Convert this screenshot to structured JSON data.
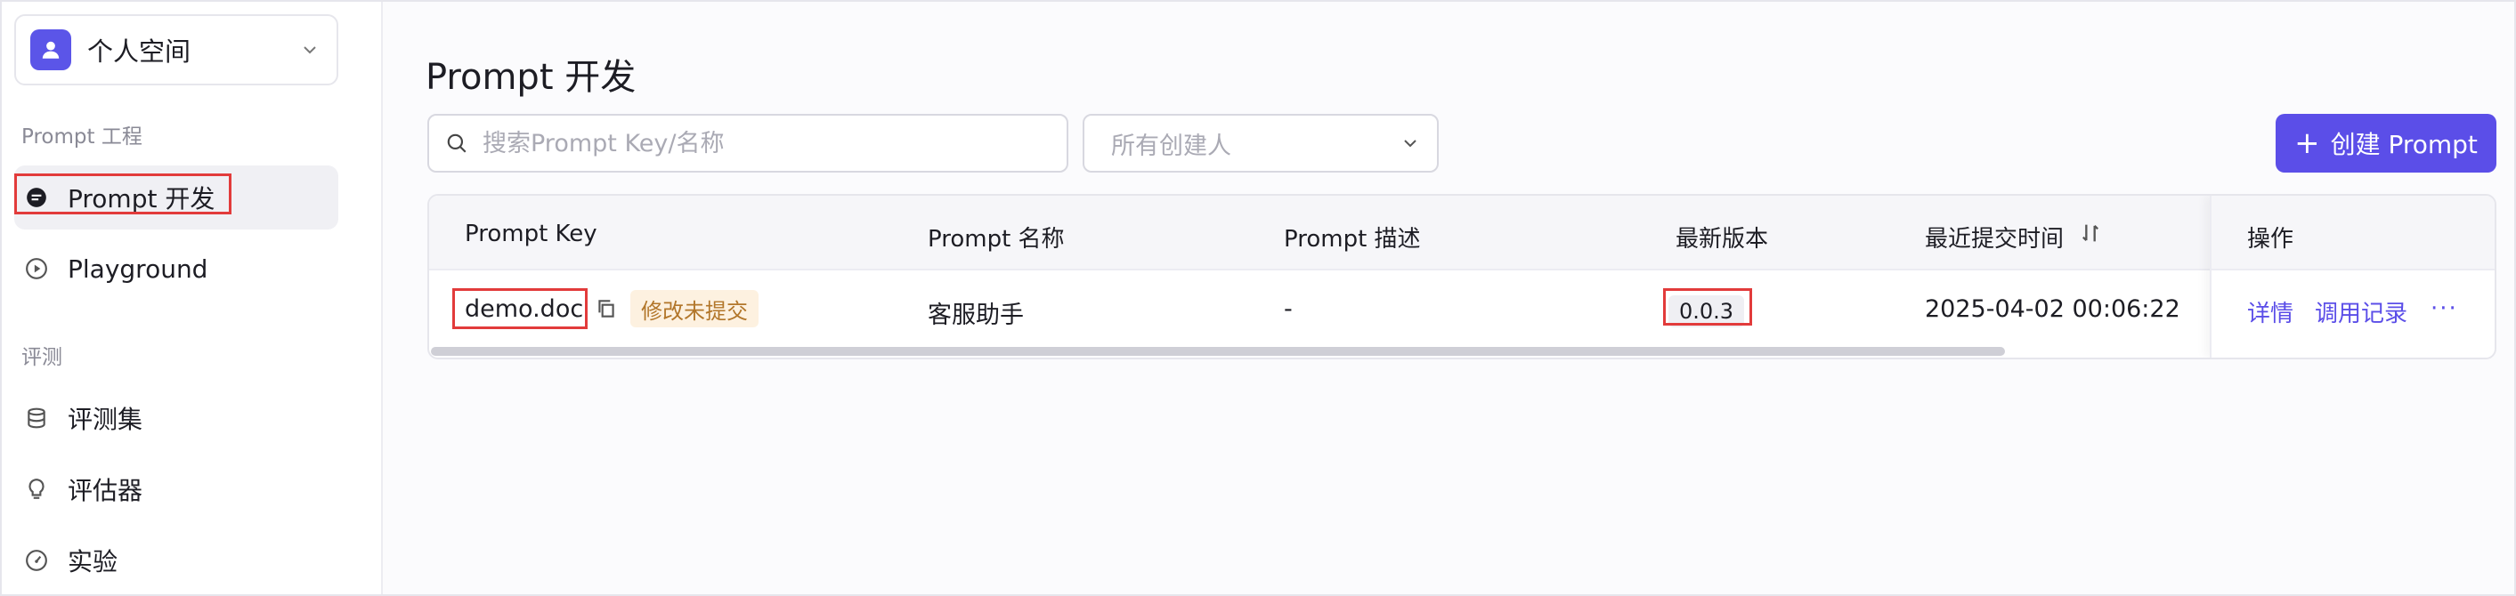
{
  "sidebar": {
    "workspace": {
      "name": "个人空间"
    },
    "sections": [
      {
        "title": "Prompt 工程"
      },
      {
        "title": "评测"
      }
    ],
    "items": [
      {
        "label": "Prompt 开发",
        "active": true
      },
      {
        "label": "Playground"
      },
      {
        "label": "评测集"
      },
      {
        "label": "评估器"
      },
      {
        "label": "实验"
      }
    ]
  },
  "main": {
    "title": "Prompt 开发",
    "search": {
      "placeholder": "搜索Prompt Key/名称",
      "value": ""
    },
    "creator_filter": {
      "placeholder": "所有创建人"
    },
    "create_button": {
      "plus": "+",
      "label": "创建 Prompt"
    },
    "table": {
      "columns": [
        "Prompt Key",
        "Prompt 名称",
        "Prompt 描述",
        "最新版本",
        "最近提交时间",
        "操作"
      ],
      "rows": [
        {
          "key": "demo.doc",
          "status_badge": "修改未提交",
          "name": "客服助手",
          "description": "-",
          "version": "0.0.3",
          "submitted_at": "2025-04-02 00:06:22",
          "actions": [
            "详情",
            "调用记录",
            "···"
          ]
        }
      ]
    }
  },
  "colors": {
    "accent": "#5b4ee8",
    "highlight_box": "#e23b3b",
    "badge_bg": "#fdf1e0",
    "badge_text": "#b2762a"
  }
}
